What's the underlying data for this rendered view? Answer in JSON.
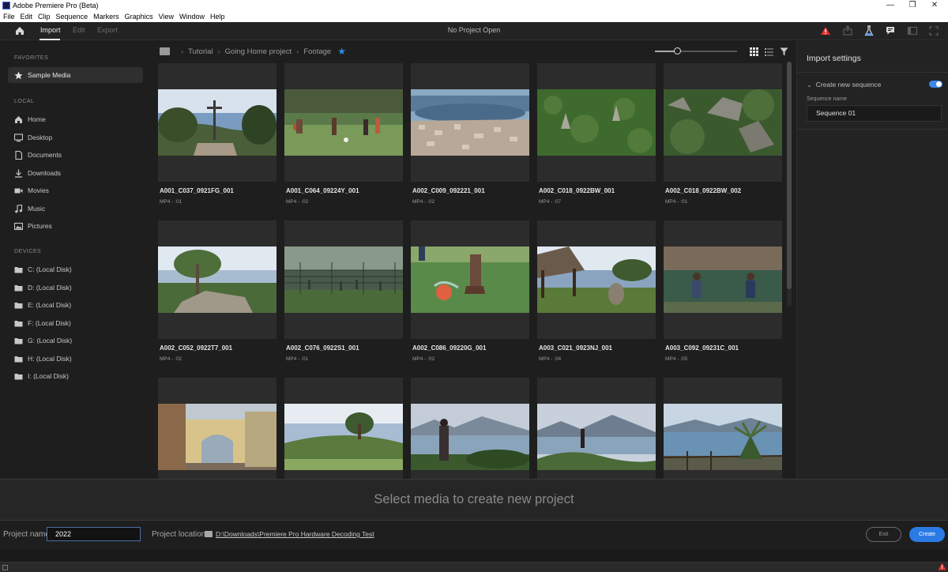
{
  "window": {
    "title": "Adobe Premiere Pro (Beta)",
    "controls": {
      "minimize": "—",
      "maximize": "❐",
      "close": "✕"
    }
  },
  "menubar": [
    "File",
    "Edit",
    "Clip",
    "Sequence",
    "Markers",
    "Graphics",
    "View",
    "Window",
    "Help"
  ],
  "header": {
    "tabs": [
      "Import",
      "Edit",
      "Export"
    ],
    "active_tab": "Import",
    "status": "No Project Open",
    "icons": [
      "warning-icon",
      "share-icon",
      "beaker-icon",
      "comment-icon",
      "panel-icon",
      "fullscreen-icon"
    ],
    "warning_color": "#e03030"
  },
  "sidebar": {
    "favorites_label": "FAVORITES",
    "favorites": [
      {
        "label": "Sample Media",
        "icon": "star-icon"
      }
    ],
    "local_label": "LOCAL",
    "local": [
      {
        "label": "Home",
        "icon": "home-icon"
      },
      {
        "label": "Desktop",
        "icon": "desktop-icon"
      },
      {
        "label": "Documents",
        "icon": "document-icon"
      },
      {
        "label": "Downloads",
        "icon": "download-icon"
      },
      {
        "label": "Movies",
        "icon": "movie-icon"
      },
      {
        "label": "Music",
        "icon": "music-icon"
      },
      {
        "label": "Pictures",
        "icon": "picture-icon"
      }
    ],
    "devices_label": "DEVICES",
    "devices": [
      {
        "label": "C: (Local Disk)",
        "icon": "folder-icon"
      },
      {
        "label": "D: (Local Disk)",
        "icon": "folder-icon"
      },
      {
        "label": "E: (Local Disk)",
        "icon": "folder-icon"
      },
      {
        "label": "F: (Local Disk)",
        "icon": "folder-icon"
      },
      {
        "label": "G: (Local Disk)",
        "icon": "folder-icon"
      },
      {
        "label": "H: (Local Disk)",
        "icon": "folder-icon"
      },
      {
        "label": "I: (Local Disk)",
        "icon": "folder-icon"
      }
    ]
  },
  "breadcrumb": [
    "Tutorial",
    "Going Home project",
    "Footage"
  ],
  "accent_color": "#2d8ceb",
  "media": [
    {
      "name": "A001_C037_0921FG_001",
      "meta": "MP4 - :01",
      "scene": "cross"
    },
    {
      "name": "A001_C064_09224Y_001",
      "meta": "MP4 - :02",
      "scene": "soccer"
    },
    {
      "name": "A002_C009_092221_001",
      "meta": "MP4 - :02",
      "scene": "aerial-town"
    },
    {
      "name": "A002_C018_0922BW_001",
      "meta": "MP4 - :07",
      "scene": "jungle"
    },
    {
      "name": "A002_C018_0922BW_002",
      "meta": "MP4 - :01",
      "scene": "ruins"
    },
    {
      "name": "A002_C052_0922T7_001",
      "meta": "MP4 - :02",
      "scene": "tree-rock"
    },
    {
      "name": "A002_C076_0922S1_001",
      "meta": "MP4 - :01",
      "scene": "fence"
    },
    {
      "name": "A002_C086_09220G_001",
      "meta": "MP4 - :02",
      "scene": "ball"
    },
    {
      "name": "A003_C021_0923NJ_001",
      "meta": "MP4 - :04",
      "scene": "hut"
    },
    {
      "name": "A003_C092_09231C_001",
      "meta": "MP4 - :05",
      "scene": "kids"
    },
    {
      "name": "",
      "meta": "",
      "scene": "arch"
    },
    {
      "name": "",
      "meta": "",
      "scene": "hill"
    },
    {
      "name": "",
      "meta": "",
      "scene": "lake-person"
    },
    {
      "name": "",
      "meta": "",
      "scene": "lake-volcano"
    },
    {
      "name": "",
      "meta": "",
      "scene": "lake-palm"
    }
  ],
  "import_settings": {
    "title": "Import settings",
    "create_sequence_label": "Create new sequence",
    "create_sequence_on": true,
    "sequence_name_label": "Sequence name",
    "sequence_name": "Sequence 01"
  },
  "dropzone": {
    "message": "Select media to create new project"
  },
  "footer": {
    "project_name_label": "Project name",
    "project_name": "2022",
    "project_location_label": "Project location",
    "project_location": "D:\\Downloads\\Premiere Pro Hardware Decoding Test",
    "exit_label": "Exit",
    "create_label": "Create",
    "create_color": "#2c7be5"
  }
}
